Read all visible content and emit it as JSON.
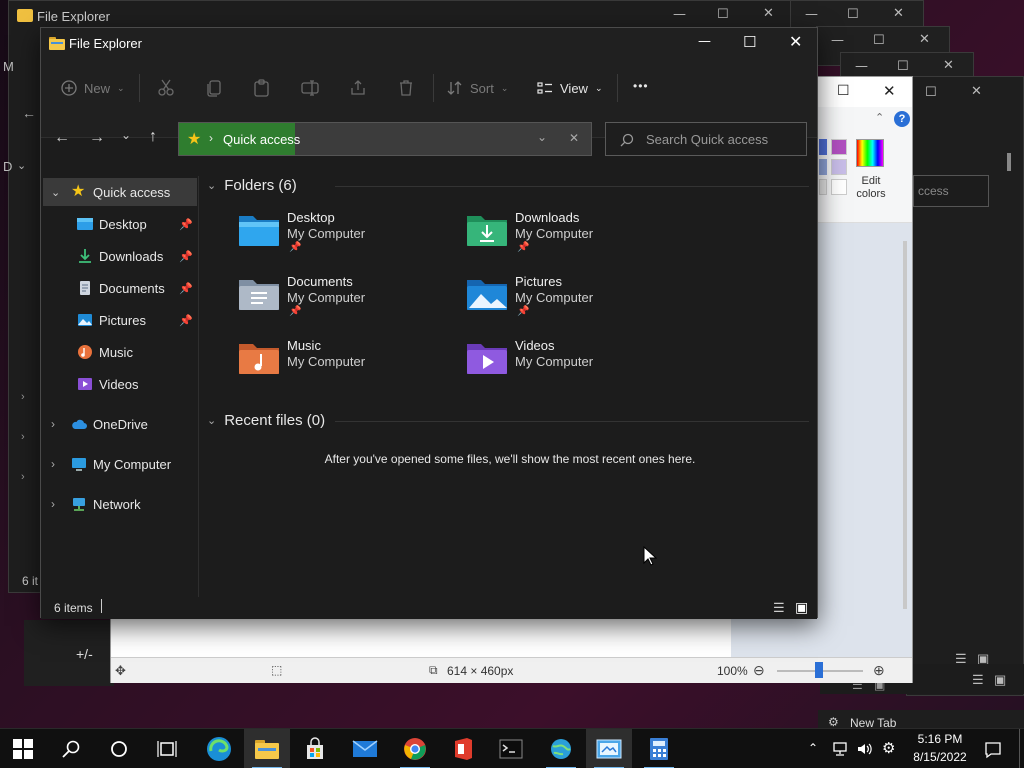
{
  "bg_windows": {
    "back_title": "File Explorer",
    "back_status": "6 it",
    "left_letter_1": "M",
    "left_letter_2": "D",
    "calc_key": "+/-"
  },
  "paint": {
    "edit_colors": "Edit colors",
    "search_fragment": "ccess",
    "status": {
      "dimensions": "614 × 460px",
      "zoom": "100%"
    }
  },
  "titlebar": {
    "title": "File Explorer"
  },
  "ribbon": {
    "new_label": "New",
    "sort_label": "Sort",
    "view_label": "View",
    "more_label": "•••"
  },
  "address": {
    "crumb": "Quick access"
  },
  "search": {
    "placeholder": "Search Quick access"
  },
  "sidebar": {
    "items": [
      {
        "label": "Quick access",
        "icon": "star-icon"
      },
      {
        "label": "Desktop",
        "icon": "desktop-folder-icon",
        "pinned": true
      },
      {
        "label": "Downloads",
        "icon": "download-icon",
        "pinned": true
      },
      {
        "label": "Documents",
        "icon": "document-icon",
        "pinned": true
      },
      {
        "label": "Pictures",
        "icon": "pictures-icon",
        "pinned": true
      },
      {
        "label": "Music",
        "icon": "music-icon"
      },
      {
        "label": "Videos",
        "icon": "videos-icon"
      },
      {
        "label": "OneDrive",
        "icon": "cloud-icon"
      },
      {
        "label": "My Computer",
        "icon": "computer-icon"
      },
      {
        "label": "Network",
        "icon": "network-icon"
      }
    ]
  },
  "main": {
    "folders_header": "Folders (6)",
    "folders": [
      {
        "name": "Desktop",
        "location": "My Computer",
        "pinned": true
      },
      {
        "name": "Downloads",
        "location": "My Computer",
        "pinned": true
      },
      {
        "name": "Documents",
        "location": "My Computer",
        "pinned": true
      },
      {
        "name": "Pictures",
        "location": "My Computer",
        "pinned": true
      },
      {
        "name": "Music",
        "location": "My Computer",
        "pinned": false
      },
      {
        "name": "Videos",
        "location": "My Computer",
        "pinned": false
      }
    ],
    "recent_header": "Recent files (0)",
    "recent_empty": "After you've opened some files, we'll show the most recent ones here."
  },
  "statusbar": {
    "count": "6 items"
  },
  "taskbar": {
    "time": "5:16 PM",
    "date": "8/15/2022",
    "new_tab": "New Tab"
  },
  "colors": {
    "accent": "#76b9ed",
    "address_fill": "#2f7d2f",
    "star": "#f5c518"
  }
}
